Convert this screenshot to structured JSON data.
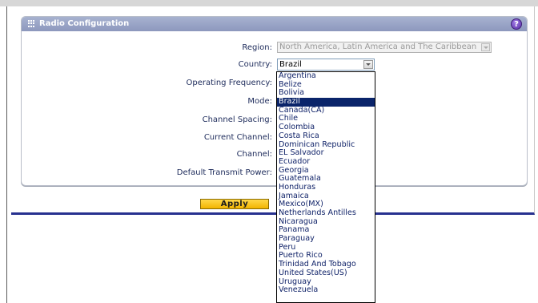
{
  "section": {
    "title": "Radio Configuration",
    "help_icon": "?"
  },
  "fields": {
    "region_label": "Region:",
    "region_value": "North America, Latin America and The Caribbean",
    "country_label": "Country:",
    "country_value": "Brazil",
    "operating_frequency_label": "Operating Frequency:",
    "mode_label": "Mode:",
    "channel_spacing_label": "Channel Spacing:",
    "current_channel_label": "Current Channel:",
    "channel_label": "Channel:",
    "default_transmit_power_label": "Default Transmit Power:"
  },
  "country_options": [
    "Argentina",
    "Belize",
    "Bolivia",
    "Brazil",
    "Canada(CA)",
    "Chile",
    "Colombia",
    "Costa Rica",
    "Dominican Republic",
    "EL Salvador",
    "Ecuador",
    "Georgia",
    "Guatemala",
    "Honduras",
    "Jamaica",
    "Mexico(MX)",
    "Netherlands Antilles",
    "Nicaragua",
    "Panama",
    "Paraguay",
    "Peru",
    "Puerto Rico",
    "Trinidad And Tobago",
    "United States(US)",
    "Uruguay",
    "Venezuela"
  ],
  "selected_country_index": 3,
  "buttons": {
    "apply_label": "Apply"
  },
  "colors": {
    "header": "#97a2c6",
    "selected_item": "#0a246a",
    "apply_button": "#f7c200",
    "bottom_rule": "#27318f"
  }
}
